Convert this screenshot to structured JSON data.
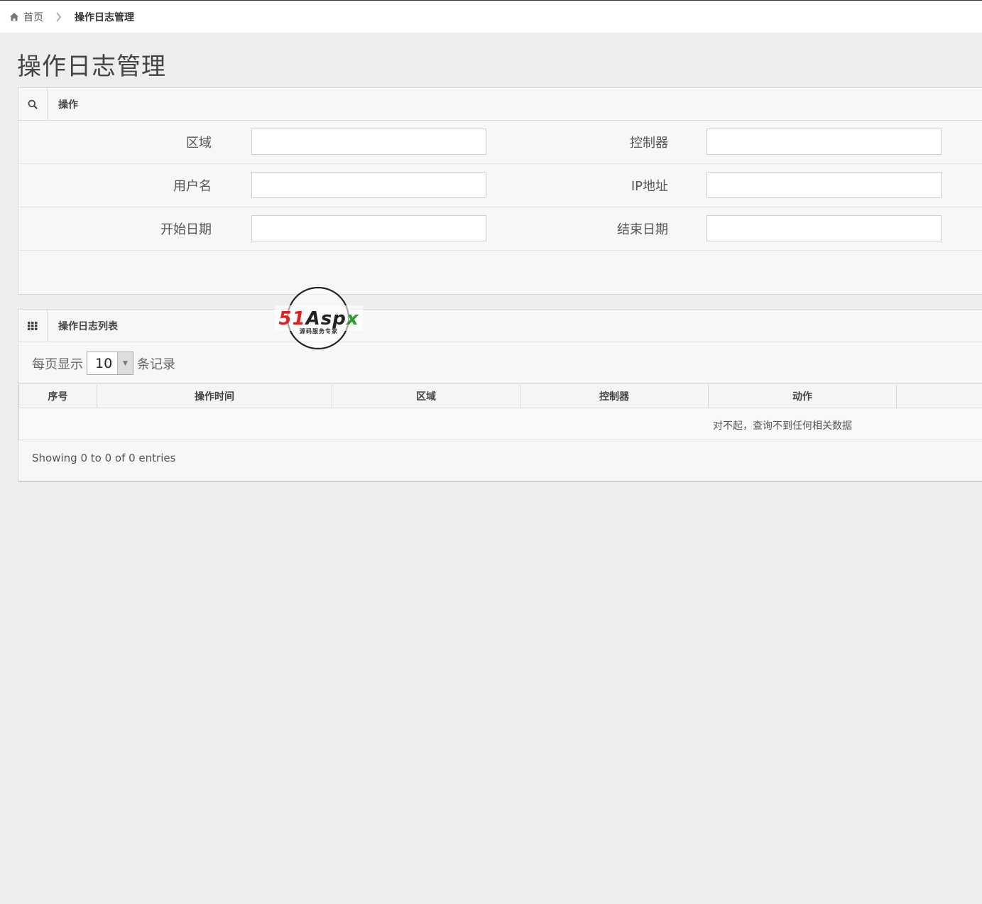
{
  "breadcrumb": {
    "home_label": "首页",
    "current_label": "操作日志管理"
  },
  "page": {
    "title": "操作日志管理"
  },
  "search_panel": {
    "title": "操作",
    "fields": {
      "area_label": "区域",
      "controller_label": "控制器",
      "username_label": "用户名",
      "ip_label": "IP地址",
      "start_date_label": "开始日期",
      "end_date_label": "结束日期",
      "area_value": "",
      "controller_value": "",
      "username_value": "",
      "ip_value": "",
      "start_date_value": "",
      "end_date_value": ""
    }
  },
  "list_panel": {
    "title": "操作日志列表",
    "page_size_prefix": "每页显示",
    "page_size_value": "10",
    "page_size_suffix": "条记录",
    "columns": [
      "序号",
      "操作时间",
      "区域",
      "控制器",
      "动作",
      ""
    ],
    "empty_message": "对不起，查询不到任何相关数据",
    "info": "Showing 0 to 0 of 0 entries"
  },
  "watermark": {
    "logo_text_red": "51",
    "logo_text_dark": "Asp",
    "logo_text_green": "x",
    "tagline": "源码服务专家"
  },
  "colors": {
    "background": "#eeeeee",
    "panel": "#f7f7f7",
    "logo_red": "#e02020",
    "logo_green": "#2aa02a"
  }
}
